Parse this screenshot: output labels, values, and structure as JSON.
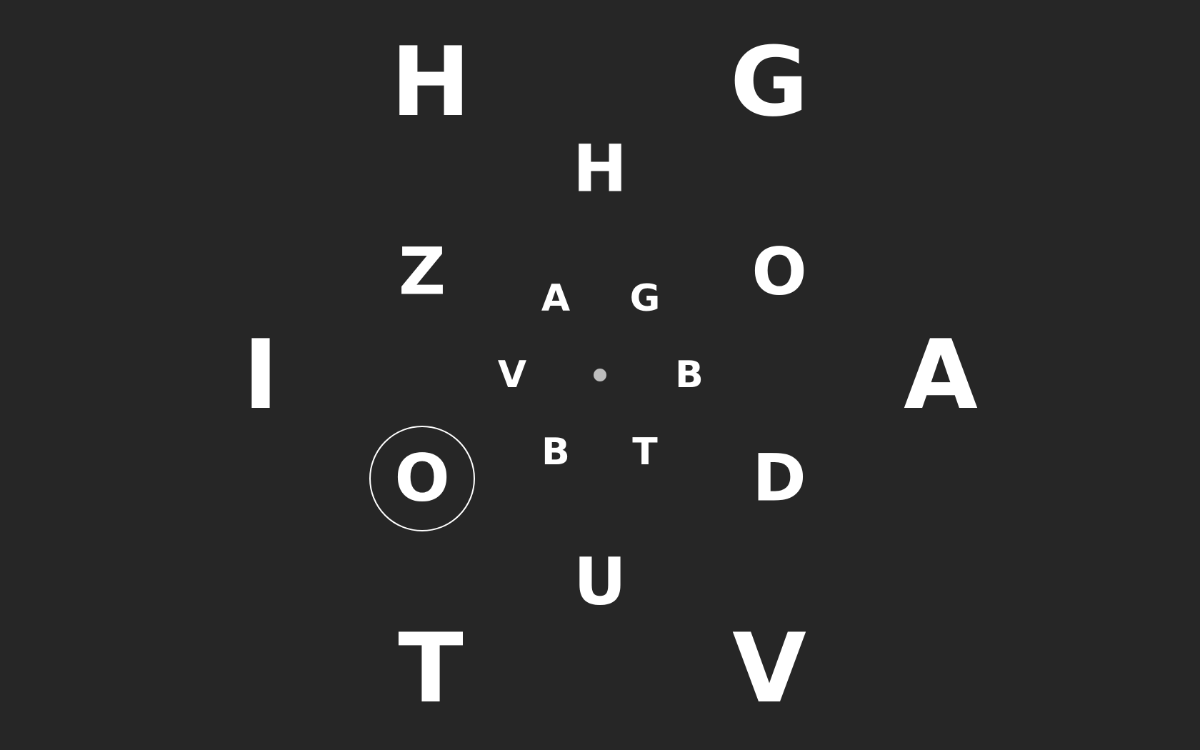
{
  "colors": {
    "background": "#262626",
    "letters": "#ffffff",
    "fixation_dot": "#bdbdbd",
    "selection_ring": "#ffffff"
  },
  "rings": {
    "outer": [
      "H",
      "G",
      "I",
      "A",
      "T",
      "V"
    ],
    "middle": [
      "H",
      "Z",
      "O",
      "O",
      "D",
      "U"
    ],
    "inner": [
      "A",
      "G",
      "V",
      "B",
      "B",
      "T"
    ]
  },
  "selected": {
    "ring": "middle",
    "index": 3,
    "letter": "O"
  }
}
